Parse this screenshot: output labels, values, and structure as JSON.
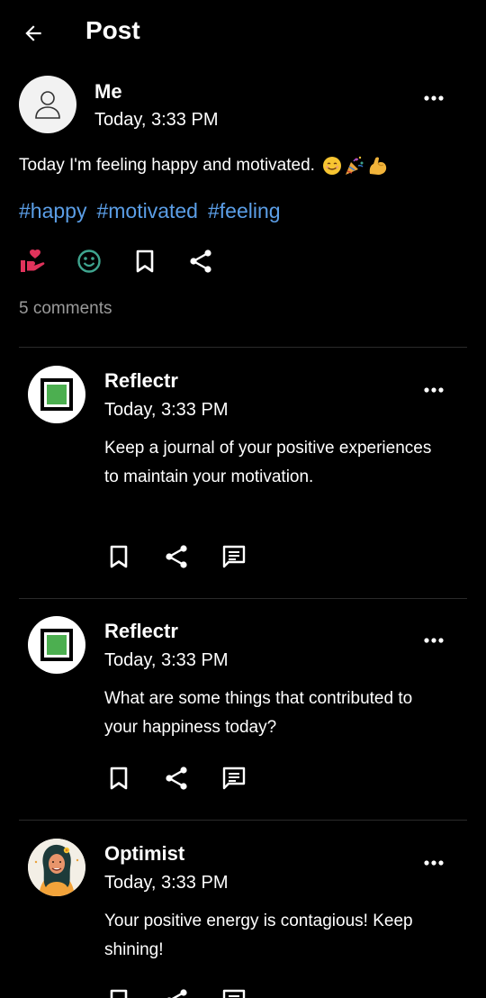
{
  "header": {
    "title": "Post"
  },
  "post": {
    "author": "Me",
    "time": "Today, 3:33 PM",
    "text": "Today I'm feeling happy and motivated.",
    "emojis": [
      "smiling-face-emoji",
      "party-popper-emoji",
      "flexed-biceps-emoji"
    ],
    "tags": [
      "#happy",
      "#motivated",
      "#feeling"
    ],
    "comment_count": "5 comments"
  },
  "comments": [
    {
      "author": "Reflectr",
      "time": "Today, 3:33 PM",
      "text": "Keep a journal of your positive experiences to maintain your motivation."
    },
    {
      "author": "Reflectr",
      "time": "Today, 3:33 PM",
      "text": "What are some things that contributed to your happiness today?"
    },
    {
      "author": "Optimist",
      "time": "Today, 3:33 PM",
      "text": "Your positive energy is contagious! Keep shining!"
    }
  ],
  "colors": {
    "background": "#000000",
    "hashtag": "#5b9ee6",
    "like": "#e0335b",
    "reaction": "#3fa58f",
    "muted": "#9a9a9a",
    "reflectr_logo": "#4caf50"
  }
}
